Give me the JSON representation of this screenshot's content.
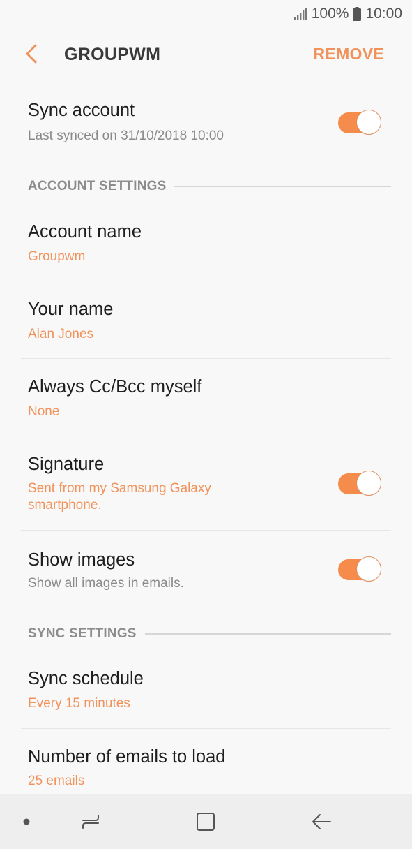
{
  "status_bar": {
    "battery": "100%",
    "time": "10:00"
  },
  "header": {
    "title": "GROUPWM",
    "remove_label": "REMOVE"
  },
  "sync_account": {
    "title": "Sync account",
    "subtitle": "Last synced on 31/10/2018  10:00",
    "enabled": true
  },
  "account_settings": {
    "section_label": "ACCOUNT SETTINGS",
    "account_name": {
      "title": "Account name",
      "value": "Groupwm"
    },
    "your_name": {
      "title": "Your name",
      "value": "Alan Jones"
    },
    "always_cc": {
      "title": "Always Cc/Bcc myself",
      "value": "None"
    },
    "signature": {
      "title": "Signature",
      "value_line1": "Sent from my Samsung Galaxy",
      "value_line2": "smartphone.",
      "enabled": true
    },
    "show_images": {
      "title": "Show images",
      "subtitle": "Show all images in emails.",
      "enabled": true
    }
  },
  "sync_settings": {
    "section_label": "SYNC SETTINGS",
    "sync_schedule": {
      "title": "Sync schedule",
      "value": "Every 15 minutes"
    },
    "emails_to_load": {
      "title": "Number of emails to load",
      "value": "25 emails"
    }
  },
  "colors": {
    "accent": "#f2925b",
    "toggle_on": "#f58c4b",
    "background": "#f8f8f8",
    "navbar": "#eeeeee"
  }
}
